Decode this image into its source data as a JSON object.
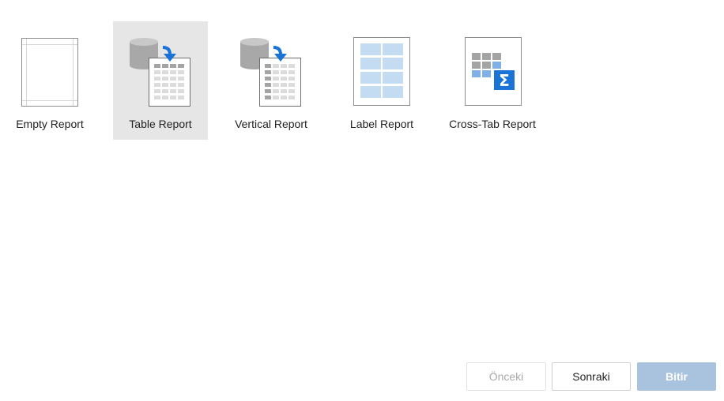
{
  "report_types": [
    {
      "label": "Empty Report",
      "icon": "empty-report-icon",
      "selected": false
    },
    {
      "label": "Table Report",
      "icon": "table-report-icon",
      "selected": true
    },
    {
      "label": "Vertical Report",
      "icon": "vertical-report-icon",
      "selected": false
    },
    {
      "label": "Label Report",
      "icon": "label-report-icon",
      "selected": false
    },
    {
      "label": "Cross-Tab Report",
      "icon": "cross-tab-report-icon",
      "selected": false
    }
  ],
  "buttons": {
    "previous": {
      "label": "Önceki",
      "enabled": false
    },
    "next": {
      "label": "Sonraki",
      "enabled": true
    },
    "finish": {
      "label": "Bitir",
      "enabled": false
    }
  },
  "colors": {
    "selected_background": "#e6e6e6",
    "accent_blue": "#1a73d6",
    "finish_button": "#a9c3df",
    "light_blue_cell": "#c4dcf2"
  }
}
